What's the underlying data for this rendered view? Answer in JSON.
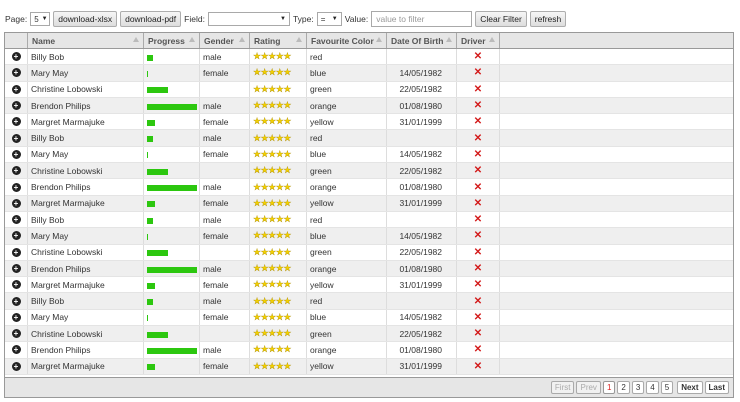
{
  "toolbar": {
    "page_label": "Page:",
    "page_size": "5",
    "download_xlsx": "download-xlsx",
    "download_pdf": "download-pdf",
    "field_label": "Field:",
    "field_value": "",
    "type_label": "Type:",
    "type_value": "=",
    "value_label": "Value:",
    "value_placeholder": "value to filter",
    "clear_filter": "Clear Filter",
    "refresh": "refresh"
  },
  "columns": [
    "Name",
    "Progress",
    "Gender",
    "Rating",
    "Favourite Color",
    "Date Of Birth",
    "Driver"
  ],
  "rows": [
    {
      "name": "Billy Bob",
      "progress": 12,
      "gender": "male",
      "rating": 5,
      "color": "red",
      "dob": "",
      "driver": false
    },
    {
      "name": "Mary May",
      "progress": 1,
      "gender": "female",
      "rating": 5,
      "color": "blue",
      "dob": "14/05/1982",
      "driver": false
    },
    {
      "name": "Christine Lobowski",
      "progress": 42,
      "gender": "",
      "rating": 5,
      "color": "green",
      "dob": "22/05/1982",
      "driver": false
    },
    {
      "name": "Brendon Philips",
      "progress": 100,
      "gender": "male",
      "rating": 5,
      "color": "orange",
      "dob": "01/08/1980",
      "driver": false
    },
    {
      "name": "Margret Marmajuke",
      "progress": 16,
      "gender": "female",
      "rating": 5,
      "color": "yellow",
      "dob": "31/01/1999",
      "driver": false
    },
    {
      "name": "Billy Bob",
      "progress": 12,
      "gender": "male",
      "rating": 5,
      "color": "red",
      "dob": "",
      "driver": false
    },
    {
      "name": "Mary May",
      "progress": 1,
      "gender": "female",
      "rating": 5,
      "color": "blue",
      "dob": "14/05/1982",
      "driver": false
    },
    {
      "name": "Christine Lobowski",
      "progress": 42,
      "gender": "",
      "rating": 5,
      "color": "green",
      "dob": "22/05/1982",
      "driver": false
    },
    {
      "name": "Brendon Philips",
      "progress": 100,
      "gender": "male",
      "rating": 5,
      "color": "orange",
      "dob": "01/08/1980",
      "driver": false
    },
    {
      "name": "Margret Marmajuke",
      "progress": 16,
      "gender": "female",
      "rating": 5,
      "color": "yellow",
      "dob": "31/01/1999",
      "driver": false
    },
    {
      "name": "Billy Bob",
      "progress": 12,
      "gender": "male",
      "rating": 5,
      "color": "red",
      "dob": "",
      "driver": false
    },
    {
      "name": "Mary May",
      "progress": 1,
      "gender": "female",
      "rating": 5,
      "color": "blue",
      "dob": "14/05/1982",
      "driver": false
    },
    {
      "name": "Christine Lobowski",
      "progress": 42,
      "gender": "",
      "rating": 5,
      "color": "green",
      "dob": "22/05/1982",
      "driver": false
    },
    {
      "name": "Brendon Philips",
      "progress": 100,
      "gender": "male",
      "rating": 5,
      "color": "orange",
      "dob": "01/08/1980",
      "driver": false
    },
    {
      "name": "Margret Marmajuke",
      "progress": 16,
      "gender": "female",
      "rating": 5,
      "color": "yellow",
      "dob": "31/01/1999",
      "driver": false
    },
    {
      "name": "Billy Bob",
      "progress": 12,
      "gender": "male",
      "rating": 5,
      "color": "red",
      "dob": "",
      "driver": false
    },
    {
      "name": "Mary May",
      "progress": 1,
      "gender": "female",
      "rating": 5,
      "color": "blue",
      "dob": "14/05/1982",
      "driver": false
    },
    {
      "name": "Christine Lobowski",
      "progress": 42,
      "gender": "",
      "rating": 5,
      "color": "green",
      "dob": "22/05/1982",
      "driver": false
    },
    {
      "name": "Brendon Philips",
      "progress": 100,
      "gender": "male",
      "rating": 5,
      "color": "orange",
      "dob": "01/08/1980",
      "driver": false
    },
    {
      "name": "Margret Marmajuke",
      "progress": 16,
      "gender": "female",
      "rating": 5,
      "color": "yellow",
      "dob": "31/01/1999",
      "driver": false
    }
  ],
  "pagination": {
    "first": "First",
    "prev": "Prev",
    "pages": [
      "1",
      "2",
      "3",
      "4",
      "5"
    ],
    "active_page": "1",
    "next": "Next",
    "last": "Last"
  },
  "colors": {
    "progress_bar": "#2cc70f",
    "driver_false": "#d31a1a",
    "star": "#f3d000",
    "header_bg": "#e6e6e6",
    "row_alt_bg": "#efefef"
  },
  "icons": {
    "row_toggle": "plus-circle-icon",
    "rating": "star-icon",
    "driver_false": "cross-icon",
    "sort": "sort-arrow-icon"
  }
}
